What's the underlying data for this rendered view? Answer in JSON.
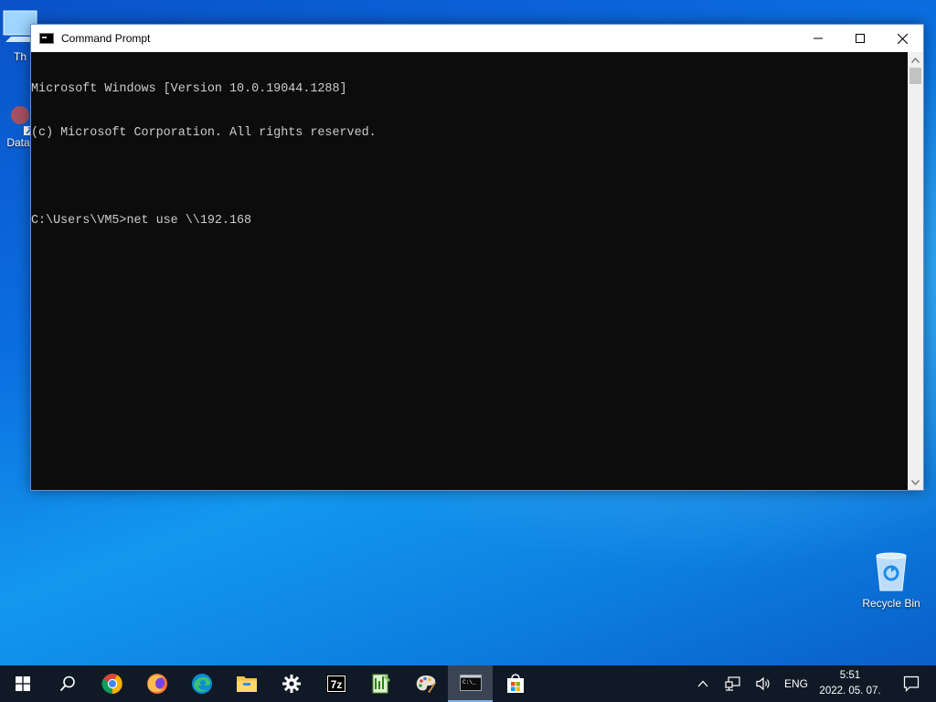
{
  "desktop": {
    "icons": [
      {
        "label": "Th"
      },
      {
        "label": "Data"
      },
      {
        "label": "Recycle Bin"
      }
    ]
  },
  "window": {
    "title": "Command Prompt",
    "console_lines": [
      "Microsoft Windows [Version 10.0.19044.1288]",
      "(c) Microsoft Corporation. All rights reserved.",
      "",
      "C:\\Users\\VM5>net use \\\\192.168"
    ]
  },
  "taskbar": {
    "apps": [
      {
        "name": "start-icon"
      },
      {
        "name": "search-icon"
      },
      {
        "name": "chrome-icon"
      },
      {
        "name": "firefox-icon"
      },
      {
        "name": "edge-icon"
      },
      {
        "name": "file-explorer-icon"
      },
      {
        "name": "settings-icon"
      },
      {
        "name": "7zip-icon"
      },
      {
        "name": "notepad-plus-icon"
      },
      {
        "name": "paint-icon"
      },
      {
        "name": "command-prompt-icon",
        "active": true
      },
      {
        "name": "store-icon"
      }
    ],
    "tray": {
      "language": "ENG",
      "time": "5:51",
      "date": "2022. 05. 07."
    }
  },
  "colors": {
    "console_bg": "#0c0c0c",
    "console_fg": "#cccccc",
    "taskbar_bg": "#101a26",
    "active_indicator": "#7fb1ea"
  }
}
